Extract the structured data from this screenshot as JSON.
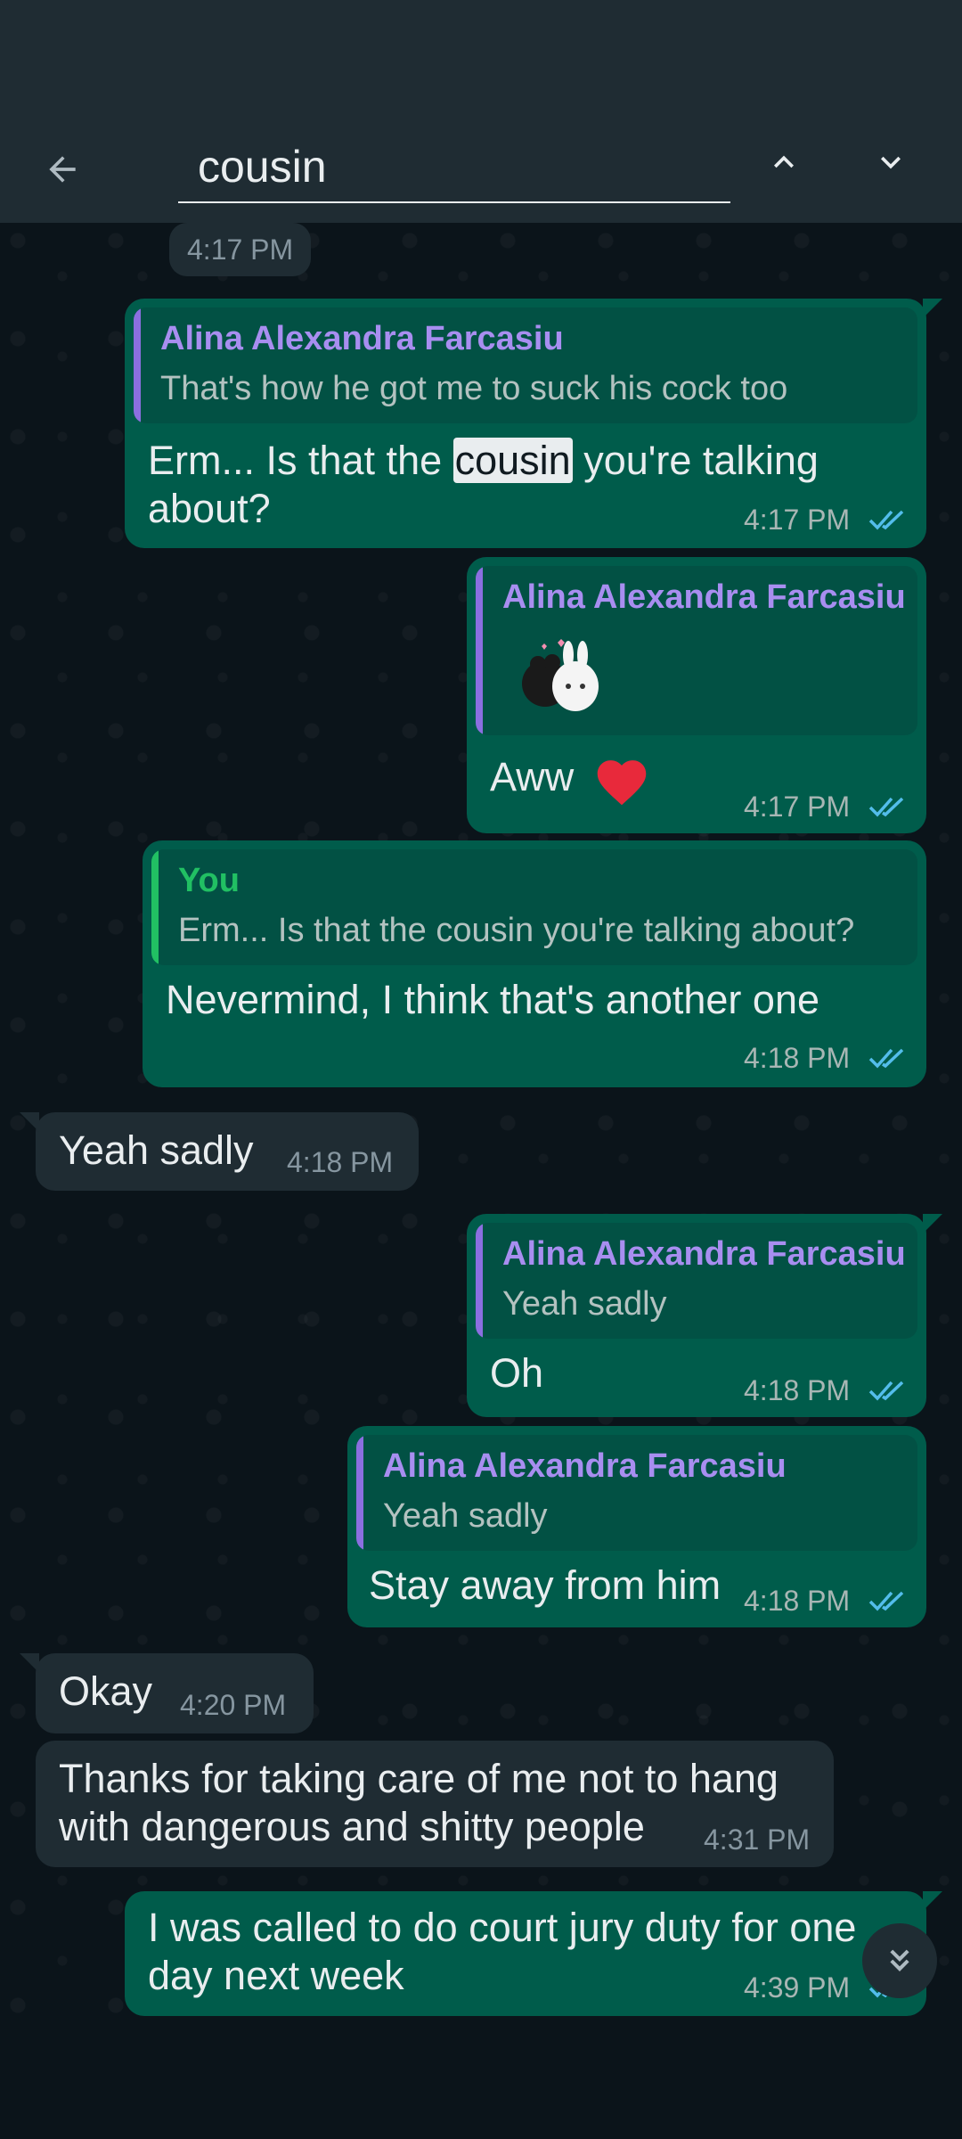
{
  "search": {
    "query": "cousin"
  },
  "icons": {
    "back": "arrow-left-icon",
    "prev": "chevron-up-icon",
    "next": "chevron-down-icon",
    "ticks": "double-check-icon",
    "scroll": "double-chevron-down-icon",
    "heart": "red-heart-emoji"
  },
  "colors": {
    "outgoing_bubble": "#005c4b",
    "incoming_bubble": "#1f2c33",
    "quote_name_purple": "#a88ef0",
    "quote_name_you": "#21c063",
    "read_ticks": "#53bdeb"
  },
  "chat": {
    "date_pill_time": "4:17 PM",
    "messages": [
      {
        "quote_name": "Alina Alexandra Farcasiu",
        "quote_text": "That's how he got me to suck his cock too",
        "text_before": "Erm...  Is that the ",
        "highlight": "cousin",
        "text_after": " you're talking about?",
        "time": "4:17 PM"
      },
      {
        "quote_name": "Alina Alexandra Farcasiu",
        "text": "Aww",
        "time": "4:17 PM"
      },
      {
        "quote_name": "You",
        "quote_text": "Erm...  Is that the cousin you're talking about?",
        "text": "Nevermind, I think that's another one",
        "time": "4:18 PM"
      },
      {
        "text": "Yeah sadly",
        "time": "4:18 PM"
      },
      {
        "quote_name": "Alina Alexandra Farcasiu",
        "quote_text": "Yeah sadly",
        "text": "Oh",
        "time": "4:18 PM"
      },
      {
        "quote_name": "Alina Alexandra Farcasiu",
        "quote_text": "Yeah sadly",
        "text": "Stay away from him",
        "time": "4:18 PM"
      },
      {
        "text": "Okay",
        "time": "4:20 PM"
      },
      {
        "text": "Thanks for taking care of me not to hang with dangerous and shitty people",
        "time": "4:31 PM"
      },
      {
        "text": "I was called to do court jury duty for one day next week",
        "time": "4:39 PM"
      }
    ]
  }
}
